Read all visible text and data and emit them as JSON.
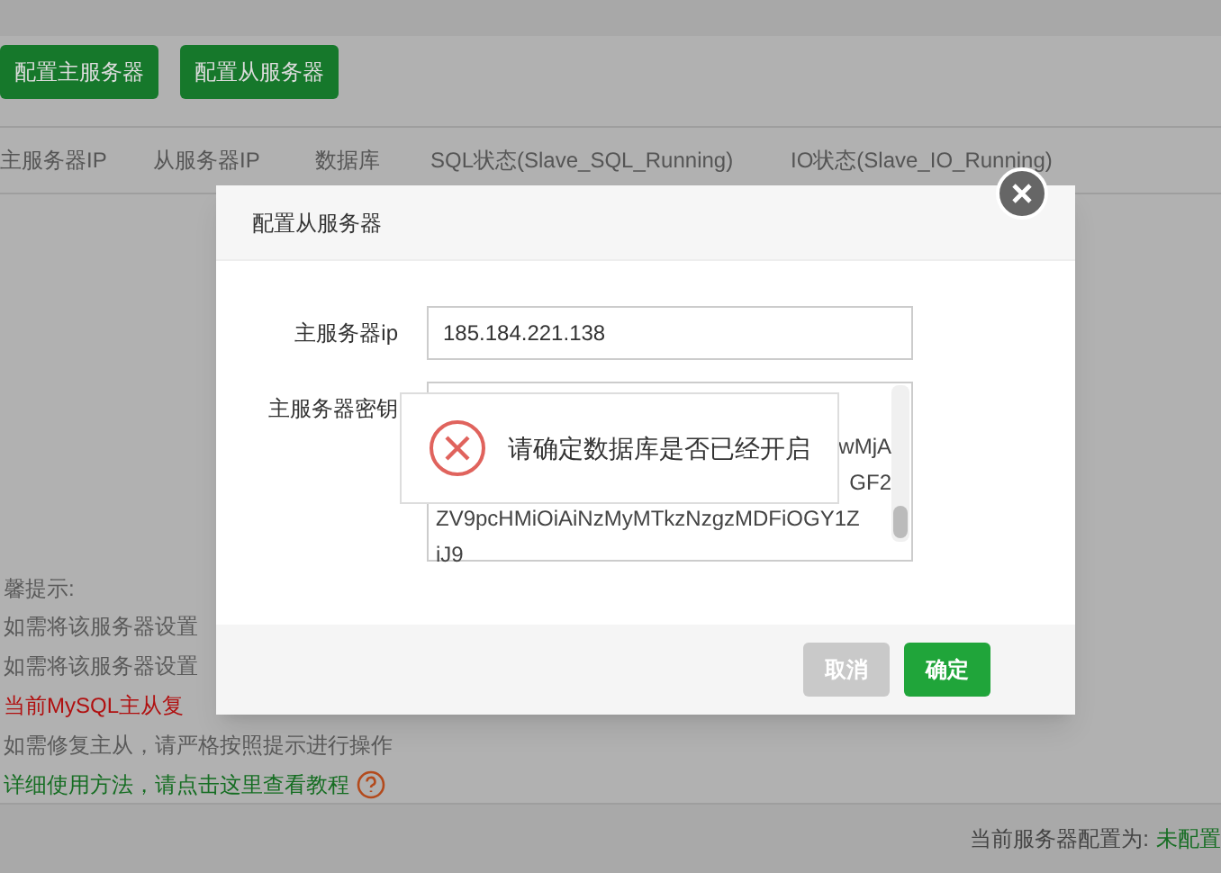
{
  "page": {
    "buttons": [
      "配置主服务器",
      "配置从服务器"
    ],
    "columns": [
      "主服务器IP",
      "从服务器IP",
      "数据库",
      "SQL状态(Slave_SQL_Running)",
      "IO状态(Slave_IO_Running)"
    ],
    "tips_title": "馨提示:",
    "tips": [
      {
        "kind": "plain",
        "text": "如需将该服务器设置"
      },
      {
        "kind": "plain",
        "text": "如需将该服务器设置"
      },
      {
        "kind": "warning",
        "text": "当前MySQL主从复"
      },
      {
        "kind": "plain",
        "text": "如需修复主从，请严格按照提示进行操作"
      },
      {
        "kind": "link",
        "text": "详细使用方法，请点击这里查看教程"
      }
    ],
    "status_label": "当前服务器配置为:",
    "status_value": "未配置"
  },
  "dialog": {
    "title": "配置从服务器",
    "ip_label": "主服务器ip",
    "ip_value": "185.184.221.138",
    "key_label": "主服务器密钥",
    "key_lines": [
      {
        "kind": "partial",
        "text": "wMjA"
      },
      {
        "kind": "partial",
        "text": "GF2"
      },
      {
        "kind": "full",
        "text": "ZV9pcHMiOiAiNzMyMTkzNzgzMDFiOGY1Z"
      },
      {
        "kind": "full",
        "text": "iJ9"
      }
    ],
    "buttons": [
      {
        "label": "取消",
        "disabled": true
      },
      {
        "label": "确定",
        "disabled": false
      }
    ]
  },
  "toast": {
    "message": "请确定数据库是否已经开启"
  }
}
